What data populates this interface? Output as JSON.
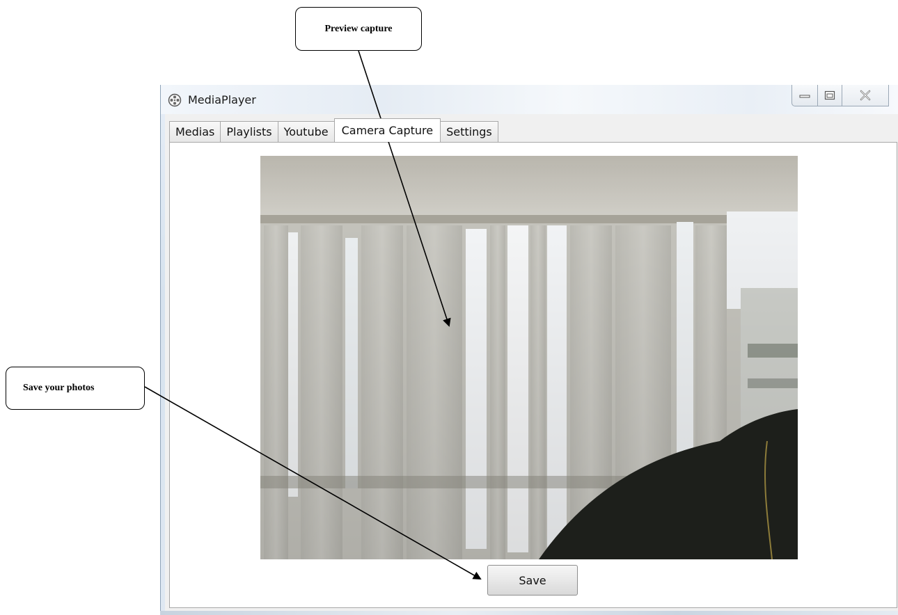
{
  "window": {
    "title": "MediaPlayer",
    "controls": {
      "minimize_icon": "minimize-icon",
      "maximize_icon": "maximize-icon",
      "close_icon": "close-icon"
    }
  },
  "tabs": [
    {
      "label": "Medias",
      "active": false
    },
    {
      "label": "Playlists",
      "active": false
    },
    {
      "label": "Youtube",
      "active": false
    },
    {
      "label": "Camera Capture",
      "active": true
    },
    {
      "label": "Settings",
      "active": false
    }
  ],
  "camera_capture": {
    "save_label": "Save"
  },
  "annotations": {
    "preview_label": "Preview capture",
    "save_label": "Save your photos"
  },
  "colors": {
    "annotation_stroke": "#000000",
    "panel_background": "#ffffff",
    "window_frame": "#dfe8f2"
  }
}
